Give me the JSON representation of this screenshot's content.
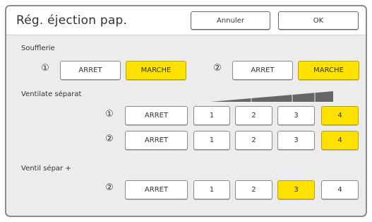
{
  "dialog": {
    "title": "Rég. éjection pap.",
    "cancel_label": "Annuler",
    "ok_label": "OK"
  },
  "soufflerie": {
    "label": "Soufflerie",
    "unit1": {
      "marker": "①",
      "off_label": "ARRET",
      "on_label": "MARCHE",
      "selected": "MARCHE"
    },
    "unit2": {
      "marker": "②",
      "off_label": "ARRET",
      "on_label": "MARCHE",
      "selected": "MARCHE"
    }
  },
  "ventilate": {
    "label": "Ventilate séparat",
    "gauge_icon": "intensity-ramp-icon",
    "row1": {
      "marker": "①",
      "off_label": "ARRET",
      "levels": [
        "1",
        "2",
        "3",
        "4"
      ],
      "selected": "4"
    },
    "row2": {
      "marker": "②",
      "off_label": "ARRET",
      "levels": [
        "1",
        "2",
        "3",
        "4"
      ],
      "selected": "4"
    }
  },
  "ventil_plus": {
    "label": "Ventil sépar +",
    "row": {
      "marker": "②",
      "off_label": "ARRET",
      "levels": [
        "1",
        "2",
        "3",
        "4"
      ],
      "selected": "3"
    }
  },
  "colors": {
    "selected": "#ffe100",
    "panel": "#ececec",
    "border": "#8c8c8c"
  }
}
